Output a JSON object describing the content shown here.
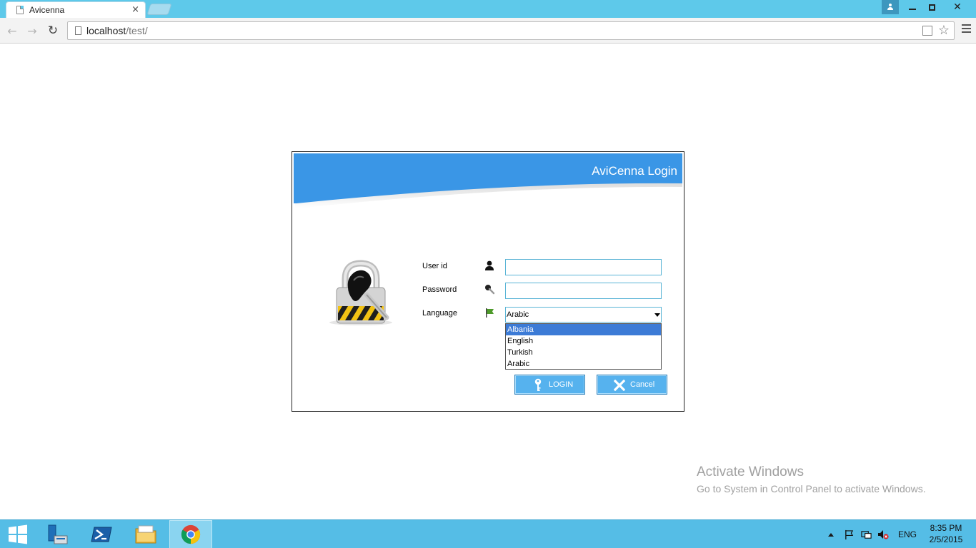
{
  "browser": {
    "tab_title": "Avicenna",
    "tab_close": "×",
    "close_glyph": "✕",
    "back_glyph": "←",
    "forward_glyph": "→",
    "reload_glyph": "↻",
    "star_glyph": "☆",
    "url_host": "localhost",
    "url_path": "/test/"
  },
  "login": {
    "title": "AviCenna Login",
    "userid_label": "User id",
    "userid_value": "",
    "password_label": "Password",
    "password_value": "",
    "language_label": "Language",
    "language_selected": "Arabic",
    "language_options": [
      "Albania",
      "English",
      "Turkish",
      "Arabic"
    ],
    "highlighted_option": "Albania",
    "login_button": "LOGIN",
    "cancel_button": "Cancel"
  },
  "icons": {
    "lock": "padlock-icon",
    "user": "user-icon",
    "password": "key-icon",
    "language": "flag-icon",
    "login": "key-icon",
    "cancel": "close-icon"
  },
  "colors": {
    "banner": "#3a96e6",
    "button": "#56b2ee",
    "taskbar": "#55bde6",
    "titlebar": "#5ec9ea",
    "dropdown_highlight": "#3c7bd6"
  },
  "watermark": {
    "title": "Activate Windows",
    "subtitle": "Go to System in Control Panel to activate Windows."
  },
  "taskbar": {
    "language": "ENG",
    "time": "8:35 PM",
    "date": "2/5/2015"
  }
}
